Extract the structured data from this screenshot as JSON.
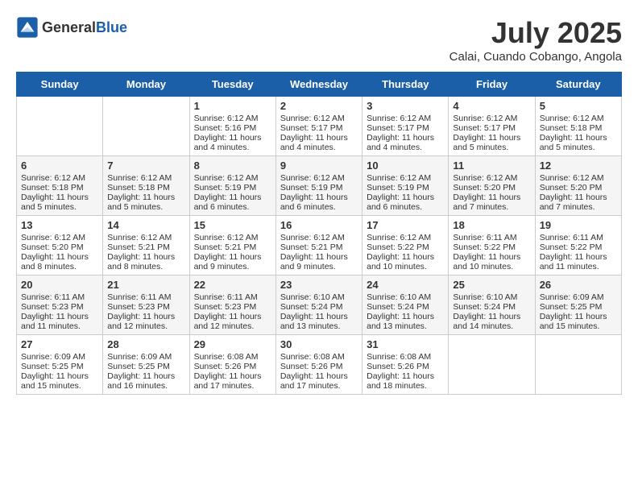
{
  "header": {
    "logo_general": "General",
    "logo_blue": "Blue",
    "month_title": "July 2025",
    "location": "Calai, Cuando Cobango, Angola"
  },
  "days_of_week": [
    "Sunday",
    "Monday",
    "Tuesday",
    "Wednesday",
    "Thursday",
    "Friday",
    "Saturday"
  ],
  "weeks": [
    [
      {
        "day": "",
        "info": ""
      },
      {
        "day": "",
        "info": ""
      },
      {
        "day": "1",
        "info": "Sunrise: 6:12 AM\nSunset: 5:16 PM\nDaylight: 11 hours and 4 minutes."
      },
      {
        "day": "2",
        "info": "Sunrise: 6:12 AM\nSunset: 5:17 PM\nDaylight: 11 hours and 4 minutes."
      },
      {
        "day": "3",
        "info": "Sunrise: 6:12 AM\nSunset: 5:17 PM\nDaylight: 11 hours and 4 minutes."
      },
      {
        "day": "4",
        "info": "Sunrise: 6:12 AM\nSunset: 5:17 PM\nDaylight: 11 hours and 5 minutes."
      },
      {
        "day": "5",
        "info": "Sunrise: 6:12 AM\nSunset: 5:18 PM\nDaylight: 11 hours and 5 minutes."
      }
    ],
    [
      {
        "day": "6",
        "info": "Sunrise: 6:12 AM\nSunset: 5:18 PM\nDaylight: 11 hours and 5 minutes."
      },
      {
        "day": "7",
        "info": "Sunrise: 6:12 AM\nSunset: 5:18 PM\nDaylight: 11 hours and 5 minutes."
      },
      {
        "day": "8",
        "info": "Sunrise: 6:12 AM\nSunset: 5:19 PM\nDaylight: 11 hours and 6 minutes."
      },
      {
        "day": "9",
        "info": "Sunrise: 6:12 AM\nSunset: 5:19 PM\nDaylight: 11 hours and 6 minutes."
      },
      {
        "day": "10",
        "info": "Sunrise: 6:12 AM\nSunset: 5:19 PM\nDaylight: 11 hours and 6 minutes."
      },
      {
        "day": "11",
        "info": "Sunrise: 6:12 AM\nSunset: 5:20 PM\nDaylight: 11 hours and 7 minutes."
      },
      {
        "day": "12",
        "info": "Sunrise: 6:12 AM\nSunset: 5:20 PM\nDaylight: 11 hours and 7 minutes."
      }
    ],
    [
      {
        "day": "13",
        "info": "Sunrise: 6:12 AM\nSunset: 5:20 PM\nDaylight: 11 hours and 8 minutes."
      },
      {
        "day": "14",
        "info": "Sunrise: 6:12 AM\nSunset: 5:21 PM\nDaylight: 11 hours and 8 minutes."
      },
      {
        "day": "15",
        "info": "Sunrise: 6:12 AM\nSunset: 5:21 PM\nDaylight: 11 hours and 9 minutes."
      },
      {
        "day": "16",
        "info": "Sunrise: 6:12 AM\nSunset: 5:21 PM\nDaylight: 11 hours and 9 minutes."
      },
      {
        "day": "17",
        "info": "Sunrise: 6:12 AM\nSunset: 5:22 PM\nDaylight: 11 hours and 10 minutes."
      },
      {
        "day": "18",
        "info": "Sunrise: 6:11 AM\nSunset: 5:22 PM\nDaylight: 11 hours and 10 minutes."
      },
      {
        "day": "19",
        "info": "Sunrise: 6:11 AM\nSunset: 5:22 PM\nDaylight: 11 hours and 11 minutes."
      }
    ],
    [
      {
        "day": "20",
        "info": "Sunrise: 6:11 AM\nSunset: 5:23 PM\nDaylight: 11 hours and 11 minutes."
      },
      {
        "day": "21",
        "info": "Sunrise: 6:11 AM\nSunset: 5:23 PM\nDaylight: 11 hours and 12 minutes."
      },
      {
        "day": "22",
        "info": "Sunrise: 6:11 AM\nSunset: 5:23 PM\nDaylight: 11 hours and 12 minutes."
      },
      {
        "day": "23",
        "info": "Sunrise: 6:10 AM\nSunset: 5:24 PM\nDaylight: 11 hours and 13 minutes."
      },
      {
        "day": "24",
        "info": "Sunrise: 6:10 AM\nSunset: 5:24 PM\nDaylight: 11 hours and 13 minutes."
      },
      {
        "day": "25",
        "info": "Sunrise: 6:10 AM\nSunset: 5:24 PM\nDaylight: 11 hours and 14 minutes."
      },
      {
        "day": "26",
        "info": "Sunrise: 6:09 AM\nSunset: 5:25 PM\nDaylight: 11 hours and 15 minutes."
      }
    ],
    [
      {
        "day": "27",
        "info": "Sunrise: 6:09 AM\nSunset: 5:25 PM\nDaylight: 11 hours and 15 minutes."
      },
      {
        "day": "28",
        "info": "Sunrise: 6:09 AM\nSunset: 5:25 PM\nDaylight: 11 hours and 16 minutes."
      },
      {
        "day": "29",
        "info": "Sunrise: 6:08 AM\nSunset: 5:26 PM\nDaylight: 11 hours and 17 minutes."
      },
      {
        "day": "30",
        "info": "Sunrise: 6:08 AM\nSunset: 5:26 PM\nDaylight: 11 hours and 17 minutes."
      },
      {
        "day": "31",
        "info": "Sunrise: 6:08 AM\nSunset: 5:26 PM\nDaylight: 11 hours and 18 minutes."
      },
      {
        "day": "",
        "info": ""
      },
      {
        "day": "",
        "info": ""
      }
    ]
  ]
}
